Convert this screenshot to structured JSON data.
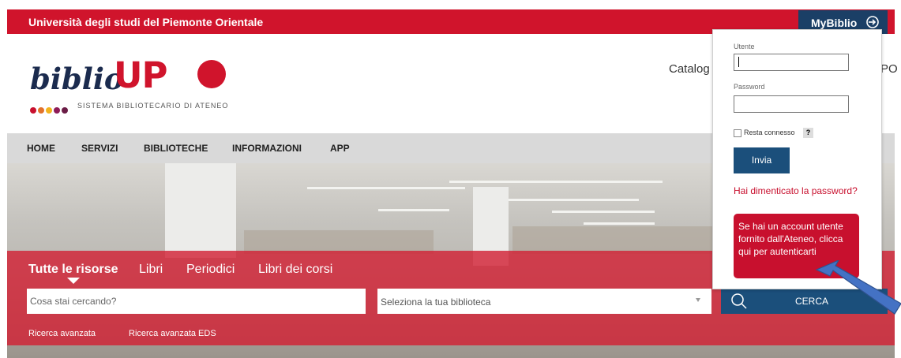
{
  "header": {
    "university_name": "Università degli studi del Piemonte Orientale",
    "mybiblio_label": "MyBiblio",
    "login_icon": "login-icon"
  },
  "logo": {
    "biblio": "biblio",
    "upo": "UP",
    "tagline": "SISTEMA BIBLIOTECARIO DI ATENEO",
    "dot_colors": [
      "#c8102e",
      "#e2732b",
      "#f2b31d",
      "#8e1b57",
      "#6b1c46"
    ]
  },
  "topnav": {
    "catalog_fragment": "Catalog",
    "upo_fragment": "PO"
  },
  "nav": {
    "items": [
      "HOME",
      "SERVIZI",
      "BIBLIOTECHE",
      "INFORMAZIONI",
      "APP"
    ]
  },
  "search": {
    "tabs": [
      "Tutte le risorse",
      "Libri",
      "Periodici",
      "Libri dei corsi"
    ],
    "active_tab": "Tutte le risorse",
    "query_placeholder": "Cosa stai cercando?",
    "library_select": "Seleziona la tua biblioteca",
    "submit_label": "CERCA",
    "advanced_links": [
      "Ricerca avanzata",
      "Ricerca avanzata EDS"
    ]
  },
  "login": {
    "user_label": "Utente",
    "user_value": "",
    "password_label": "Password",
    "password_value": "",
    "remember_label": "Resta connesso",
    "help_label": "?",
    "remember_checked": false,
    "submit_label": "Invia",
    "forgot_link": "Hai dimenticato la password?",
    "sso_note": "Se hai un account utente fornito dall'Ateneo, clicca qui per autenticarti"
  },
  "colors": {
    "brand_red": "#d0142c",
    "navy": "#1b3f66",
    "button_blue": "#1b4f7b",
    "nav_grey": "#d9d9d9"
  }
}
